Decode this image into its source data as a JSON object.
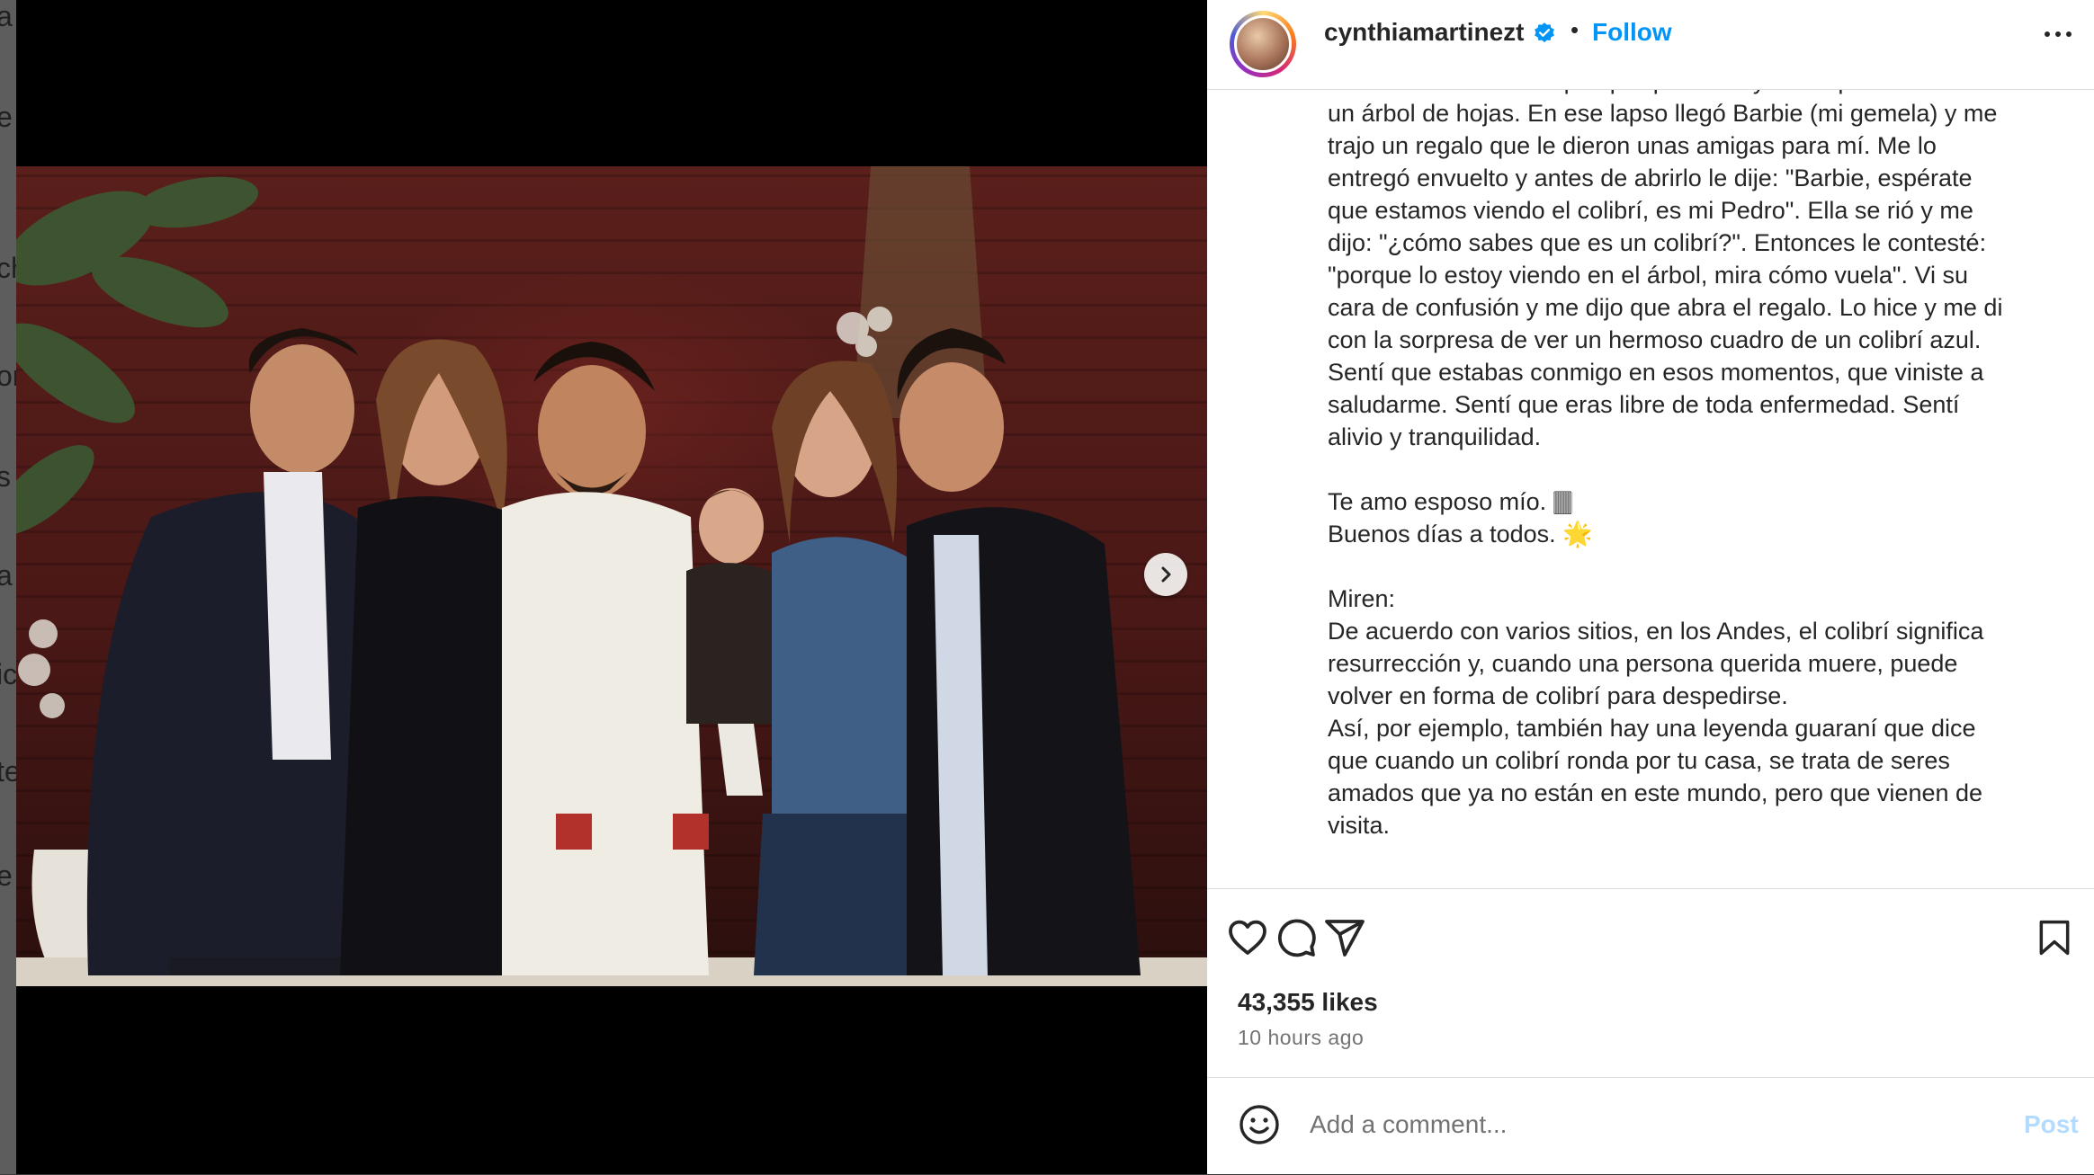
{
  "backdrop": {
    "fragments": [
      "a",
      "e",
      "ch",
      "or",
      "s",
      "a",
      "ic",
      "te",
      "e"
    ]
  },
  "post": {
    "username": "cynthiamartinezt",
    "follow_label": "Follow",
    "separator": "•",
    "carousel": {
      "slide_count": 2,
      "active_slide": 1
    },
    "caption_lines": [
      "nunca veo en esas copas porque no hay flores pues este es",
      "un árbol de hojas. En ese lapso llegó Barbie (mi gemela) y me",
      "trajo un regalo que le dieron unas amigas para mí. Me lo",
      "entregó envuelto y antes de abrirlo le dije: \"Barbie, espérate",
      "que estamos viendo el colibrí, es mi Pedro\". Ella se rió y me",
      "dijo: \"¿cómo sabes que es un colibrí?\". Entonces le contesté:",
      "\"porque lo estoy viendo en el árbol, mira cómo vuela\". Vi su",
      "cara de confusión y me dijo que abra el regalo. Lo hice y me di",
      "con la sorpresa de ver un hermoso cuadro de un colibrí azul.",
      "Sentí que estabas conmigo en esos momentos, que viniste a",
      "saludarme. Sentí que eras libre de toda enfermedad. Sentí",
      "alivio y tranquilidad.",
      "",
      "Te amo esposo mío. 🀫",
      "Buenos días a todos. 🌟",
      "",
      "Miren:",
      "De acuerdo con varios sitios, en los Andes, el colibrí significa",
      "resurrección y, cuando una persona querida muere, puede",
      "volver en forma de colibrí para despedirse.",
      "Así, por ejemplo, también hay una leyenda guaraní que dice",
      "que cuando un colibrí ronda por tu casa, se trata de seres",
      "amados que ya no están en este mundo, pero que vienen de",
      "visita."
    ],
    "likes": "43,355 likes",
    "time_ago": "10 hours ago",
    "comment_placeholder": "Add a comment...",
    "post_label": "Post"
  },
  "colors": {
    "follow": "#0095f6",
    "post_disabled": "#b3dbff",
    "verified": "#0095f6"
  }
}
